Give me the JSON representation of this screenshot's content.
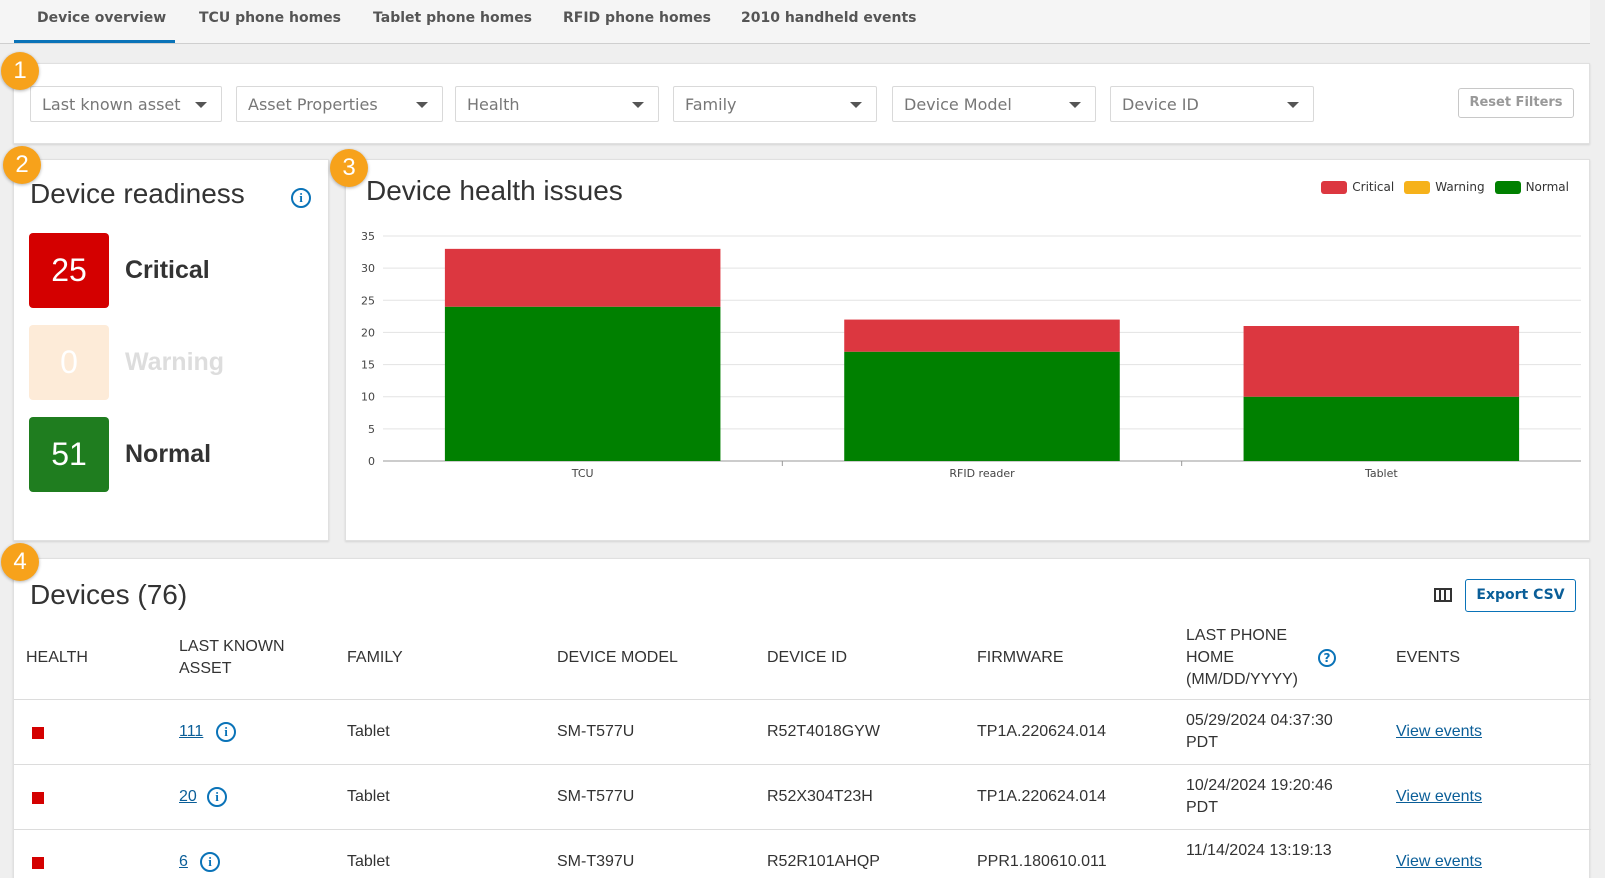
{
  "tabs": [
    "Device overview",
    "TCU phone homes",
    "Tablet phone homes",
    "RFID phone homes",
    "2010 handheld events"
  ],
  "filters": {
    "dropdowns": [
      "Last known asset",
      "Asset Properties",
      "Health",
      "Family",
      "Device Model",
      "Device ID"
    ],
    "reset_label": "Reset Filters"
  },
  "callouts": [
    "1",
    "2",
    "3",
    "4"
  ],
  "readiness": {
    "title": "Device readiness",
    "info_icon": "info-icon",
    "stats": [
      {
        "value": "25",
        "label": "Critical",
        "color": "#d40000"
      },
      {
        "value": "0",
        "label": "Warning",
        "color": "#fdebd8"
      },
      {
        "value": "51",
        "label": "Normal",
        "color": "#1f7d1f"
      }
    ]
  },
  "health": {
    "title": "Device health issues",
    "legend": [
      {
        "name": "Critical",
        "color": "#dc3740"
      },
      {
        "name": "Warning",
        "color": "#f6b21b"
      },
      {
        "name": "Normal",
        "color": "#008000"
      }
    ]
  },
  "chart_data": {
    "type": "bar",
    "stacked": true,
    "categories": [
      "TCU",
      "RFID reader",
      "Tablet"
    ],
    "series": [
      {
        "name": "Normal",
        "values": [
          24,
          17,
          10
        ],
        "color": "#008000"
      },
      {
        "name": "Warning",
        "values": [
          0,
          0,
          0
        ],
        "color": "#f6b21b"
      },
      {
        "name": "Critical",
        "values": [
          9,
          5,
          11
        ],
        "color": "#dc3740"
      }
    ],
    "ylim": [
      0,
      35
    ],
    "yticks": [
      "0",
      "5",
      "10",
      "15",
      "20",
      "25",
      "30",
      "35"
    ],
    "grid": true,
    "legend_position": "top-right"
  },
  "devices": {
    "title": "Devices (76)",
    "export_label": "Export CSV",
    "columns_icon": "columns-icon",
    "headers": [
      "HEALTH",
      "LAST KNOWN ASSET",
      "FAMILY",
      "DEVICE MODEL",
      "DEVICE ID",
      "FIRMWARE",
      "LAST PHONE HOME (MM/DD/YYYY)",
      "EVENTS"
    ],
    "rows": [
      {
        "asset": "111",
        "family": "Tablet",
        "model": "SM-T577U",
        "device_id": "R52T4018GYW",
        "firmware": "TP1A.220624.014",
        "last_home": "05/29/2024 04:37:30 PDT",
        "events": "View events"
      },
      {
        "asset": "20",
        "family": "Tablet",
        "model": "SM-T577U",
        "device_id": "R52X304T23H",
        "firmware": "TP1A.220624.014",
        "last_home": "10/24/2024 19:20:46 PDT",
        "events": "View events"
      },
      {
        "asset": "6",
        "family": "Tablet",
        "model": "SM-T397U",
        "device_id": "R52R101AHQP",
        "firmware": "PPR1.180610.011",
        "last_home": "11/14/2024 13:19:13",
        "events": "View events"
      }
    ]
  }
}
